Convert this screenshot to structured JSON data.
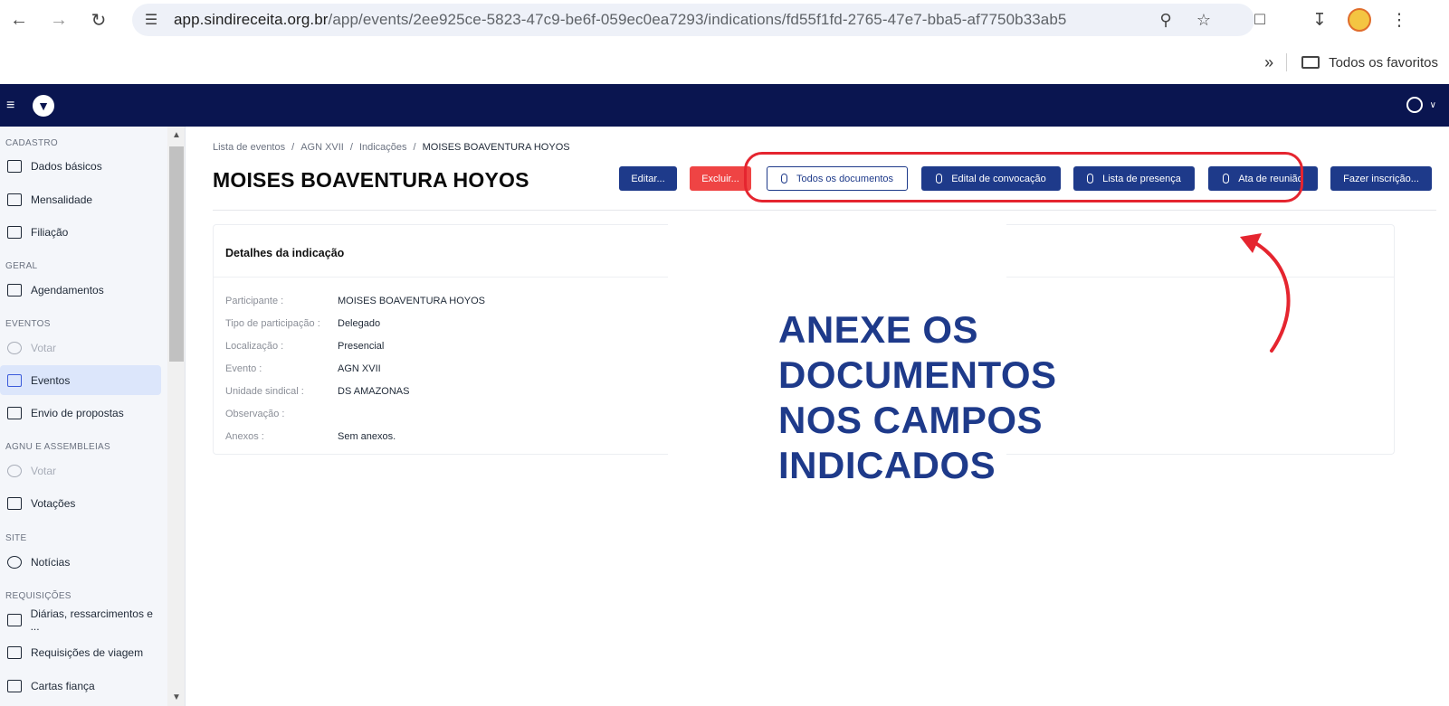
{
  "browser": {
    "url_host": "app.sindireceita.org.br",
    "url_path": "/app/events/2ee925ce-5823-47c9-be6f-059ec0ea7293/indications/fd55f1fd-2765-47e7-bba5-af7750b33ab5",
    "bookmarks_label": "Todos os favoritos"
  },
  "sidebar": {
    "sections": [
      {
        "title": "CADASTRO"
      },
      {
        "title": "GERAL"
      },
      {
        "title": "EVENTOS"
      },
      {
        "title": "AGNU E ASSEMBLEIAS"
      },
      {
        "title": "SITE"
      },
      {
        "title": "REQUISIÇÕES"
      }
    ],
    "items": [
      {
        "label": "Dados básicos",
        "icon": "id-card-icon"
      },
      {
        "label": "Mensalidade",
        "icon": "calendar-icon"
      },
      {
        "label": "Filiação",
        "icon": "document-icon"
      },
      {
        "label": "Agendamentos",
        "icon": "calendar-icon"
      },
      {
        "label": "Votar",
        "icon": "vote-icon"
      },
      {
        "label": "Eventos",
        "icon": "calendar-icon"
      },
      {
        "label": "Envio de propostas",
        "icon": "file-icon"
      },
      {
        "label": "Votar",
        "icon": "vote-icon"
      },
      {
        "label": "Votações",
        "icon": "list-icon"
      },
      {
        "label": "Notícias",
        "icon": "globe-icon"
      },
      {
        "label": "Diárias, ressarcimentos e ...",
        "icon": "receipt-icon"
      },
      {
        "label": "Requisições de viagem",
        "icon": "luggage-icon"
      },
      {
        "label": "Cartas fiança",
        "icon": "letter-icon"
      }
    ]
  },
  "breadcrumb": {
    "items": [
      "Lista de eventos",
      "AGN XVII",
      "Indicações",
      "MOISES BOAVENTURA HOYOS"
    ]
  },
  "page": {
    "title": "MOISES BOAVENTURA HOYOS"
  },
  "actions": {
    "edit": "Editar...",
    "delete": "Excluir...",
    "all_docs": "Todos os documentos",
    "edital": "Edital de convocação",
    "lista": "Lista de presença",
    "ata": "Ata de reunião",
    "inscricao": "Fazer inscrição..."
  },
  "details": {
    "title": "Detalhes da indicação",
    "rows": [
      {
        "label": "Participante :",
        "value": "MOISES BOAVENTURA HOYOS"
      },
      {
        "label": "Tipo de participação :",
        "value": "Delegado"
      },
      {
        "label": "Localização :",
        "value": "Presencial"
      },
      {
        "label": "Evento :",
        "value": "AGN XVII"
      },
      {
        "label": "Unidade sindical :",
        "value": "DS AMAZONAS"
      },
      {
        "label": "Observação :",
        "value": ""
      },
      {
        "label": "Anexos :",
        "value": "Sem anexos."
      }
    ]
  },
  "annotation": {
    "line1": "ANEXE OS DOCUMENTOS",
    "line2": "NOS CAMPOS INDICADOS",
    "color": "#1e3a8a",
    "highlight_color": "#e5252f"
  }
}
